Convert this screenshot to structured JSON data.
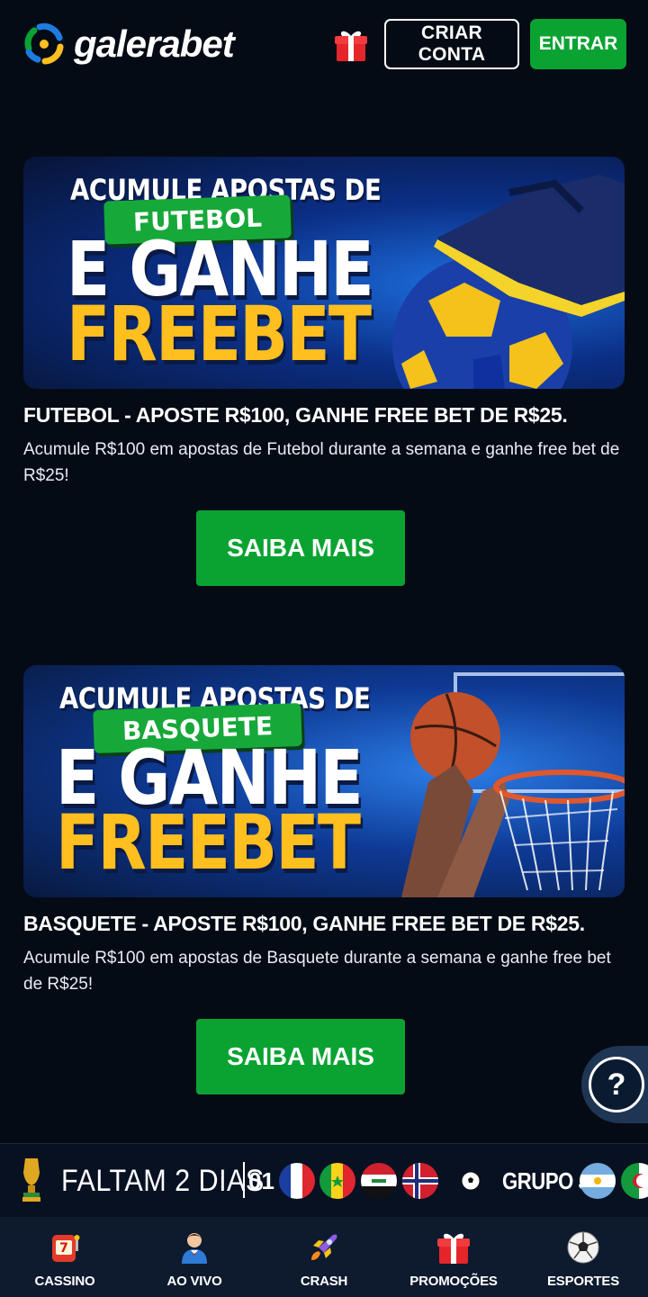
{
  "header": {
    "logo_text": "galerabet",
    "create_account_label": "CRIAR CONTA",
    "login_label": "ENTRAR"
  },
  "promos": [
    {
      "banner_line1": "ACUMULE APOSTAS DE",
      "banner_tag": "FUTEBOL",
      "banner_line2": "E GANHE",
      "banner_line3": "FREEBET",
      "title": "FUTEBOL - APOSTE R$100, GANHE FREE BET DE R$25.",
      "description": "Acumule R$100 em apostas de Futebol durante a semana e ganhe free bet de R$25!",
      "button_label": "SAIBA MAIS"
    },
    {
      "banner_line1": "ACUMULE APOSTAS DE",
      "banner_tag": "BASQUETE",
      "banner_line2": "E GANHE",
      "banner_line3": "FREEBET",
      "title": "BASQUETE - APOSTE R$100, GANHE FREE BET DE R$25.",
      "description": "Acumule R$100 em apostas de Basquete durante a semana e ganhe free bet de R$25!",
      "button_label": "SAIBA MAIS"
    }
  ],
  "help": {
    "label": "?"
  },
  "ticker": {
    "countdown": "FALTAM 2 DIAS",
    "number": "01",
    "group": "GRUPO J"
  },
  "bottom_nav": [
    {
      "label": "CASSINO",
      "icon": "slot-machine-icon"
    },
    {
      "label": "AO VIVO",
      "icon": "dealer-icon"
    },
    {
      "label": "CRASH",
      "icon": "rocket-icon"
    },
    {
      "label": "PROMOÇÕES",
      "icon": "gift-icon"
    },
    {
      "label": "ESPORTES",
      "icon": "soccer-ball-icon"
    }
  ],
  "colors": {
    "background": "#050b15",
    "accent_green": "#0aa332",
    "freebet_yellow": "#ffbf1f",
    "nav_bg": "#0e1a2e"
  }
}
